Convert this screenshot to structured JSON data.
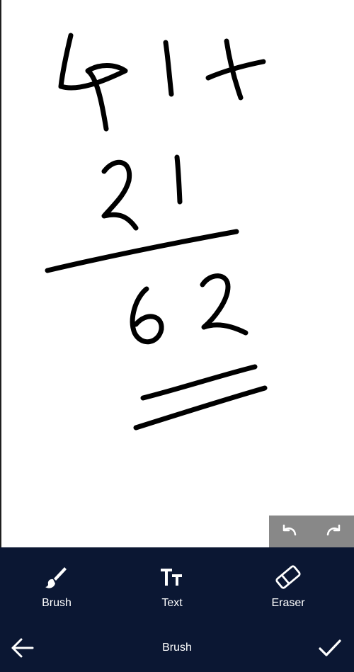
{
  "canvas": {
    "drawing": "handwritten addition",
    "stroke_color": "#000000"
  },
  "history": {
    "undo_icon": "undo-icon",
    "redo_icon": "redo-icon"
  },
  "tools": [
    {
      "label": "Brush",
      "icon": "brush-icon"
    },
    {
      "label": "Text",
      "icon": "text-icon"
    },
    {
      "label": "Eraser",
      "icon": "eraser-icon"
    }
  ],
  "bottom_bar": {
    "title": "Brush",
    "back_icon": "arrow-left-icon",
    "confirm_icon": "checkmark-icon"
  },
  "colors": {
    "panel_bg": "#0b1733",
    "history_bg": "#888888",
    "icon": "#ffffff"
  }
}
